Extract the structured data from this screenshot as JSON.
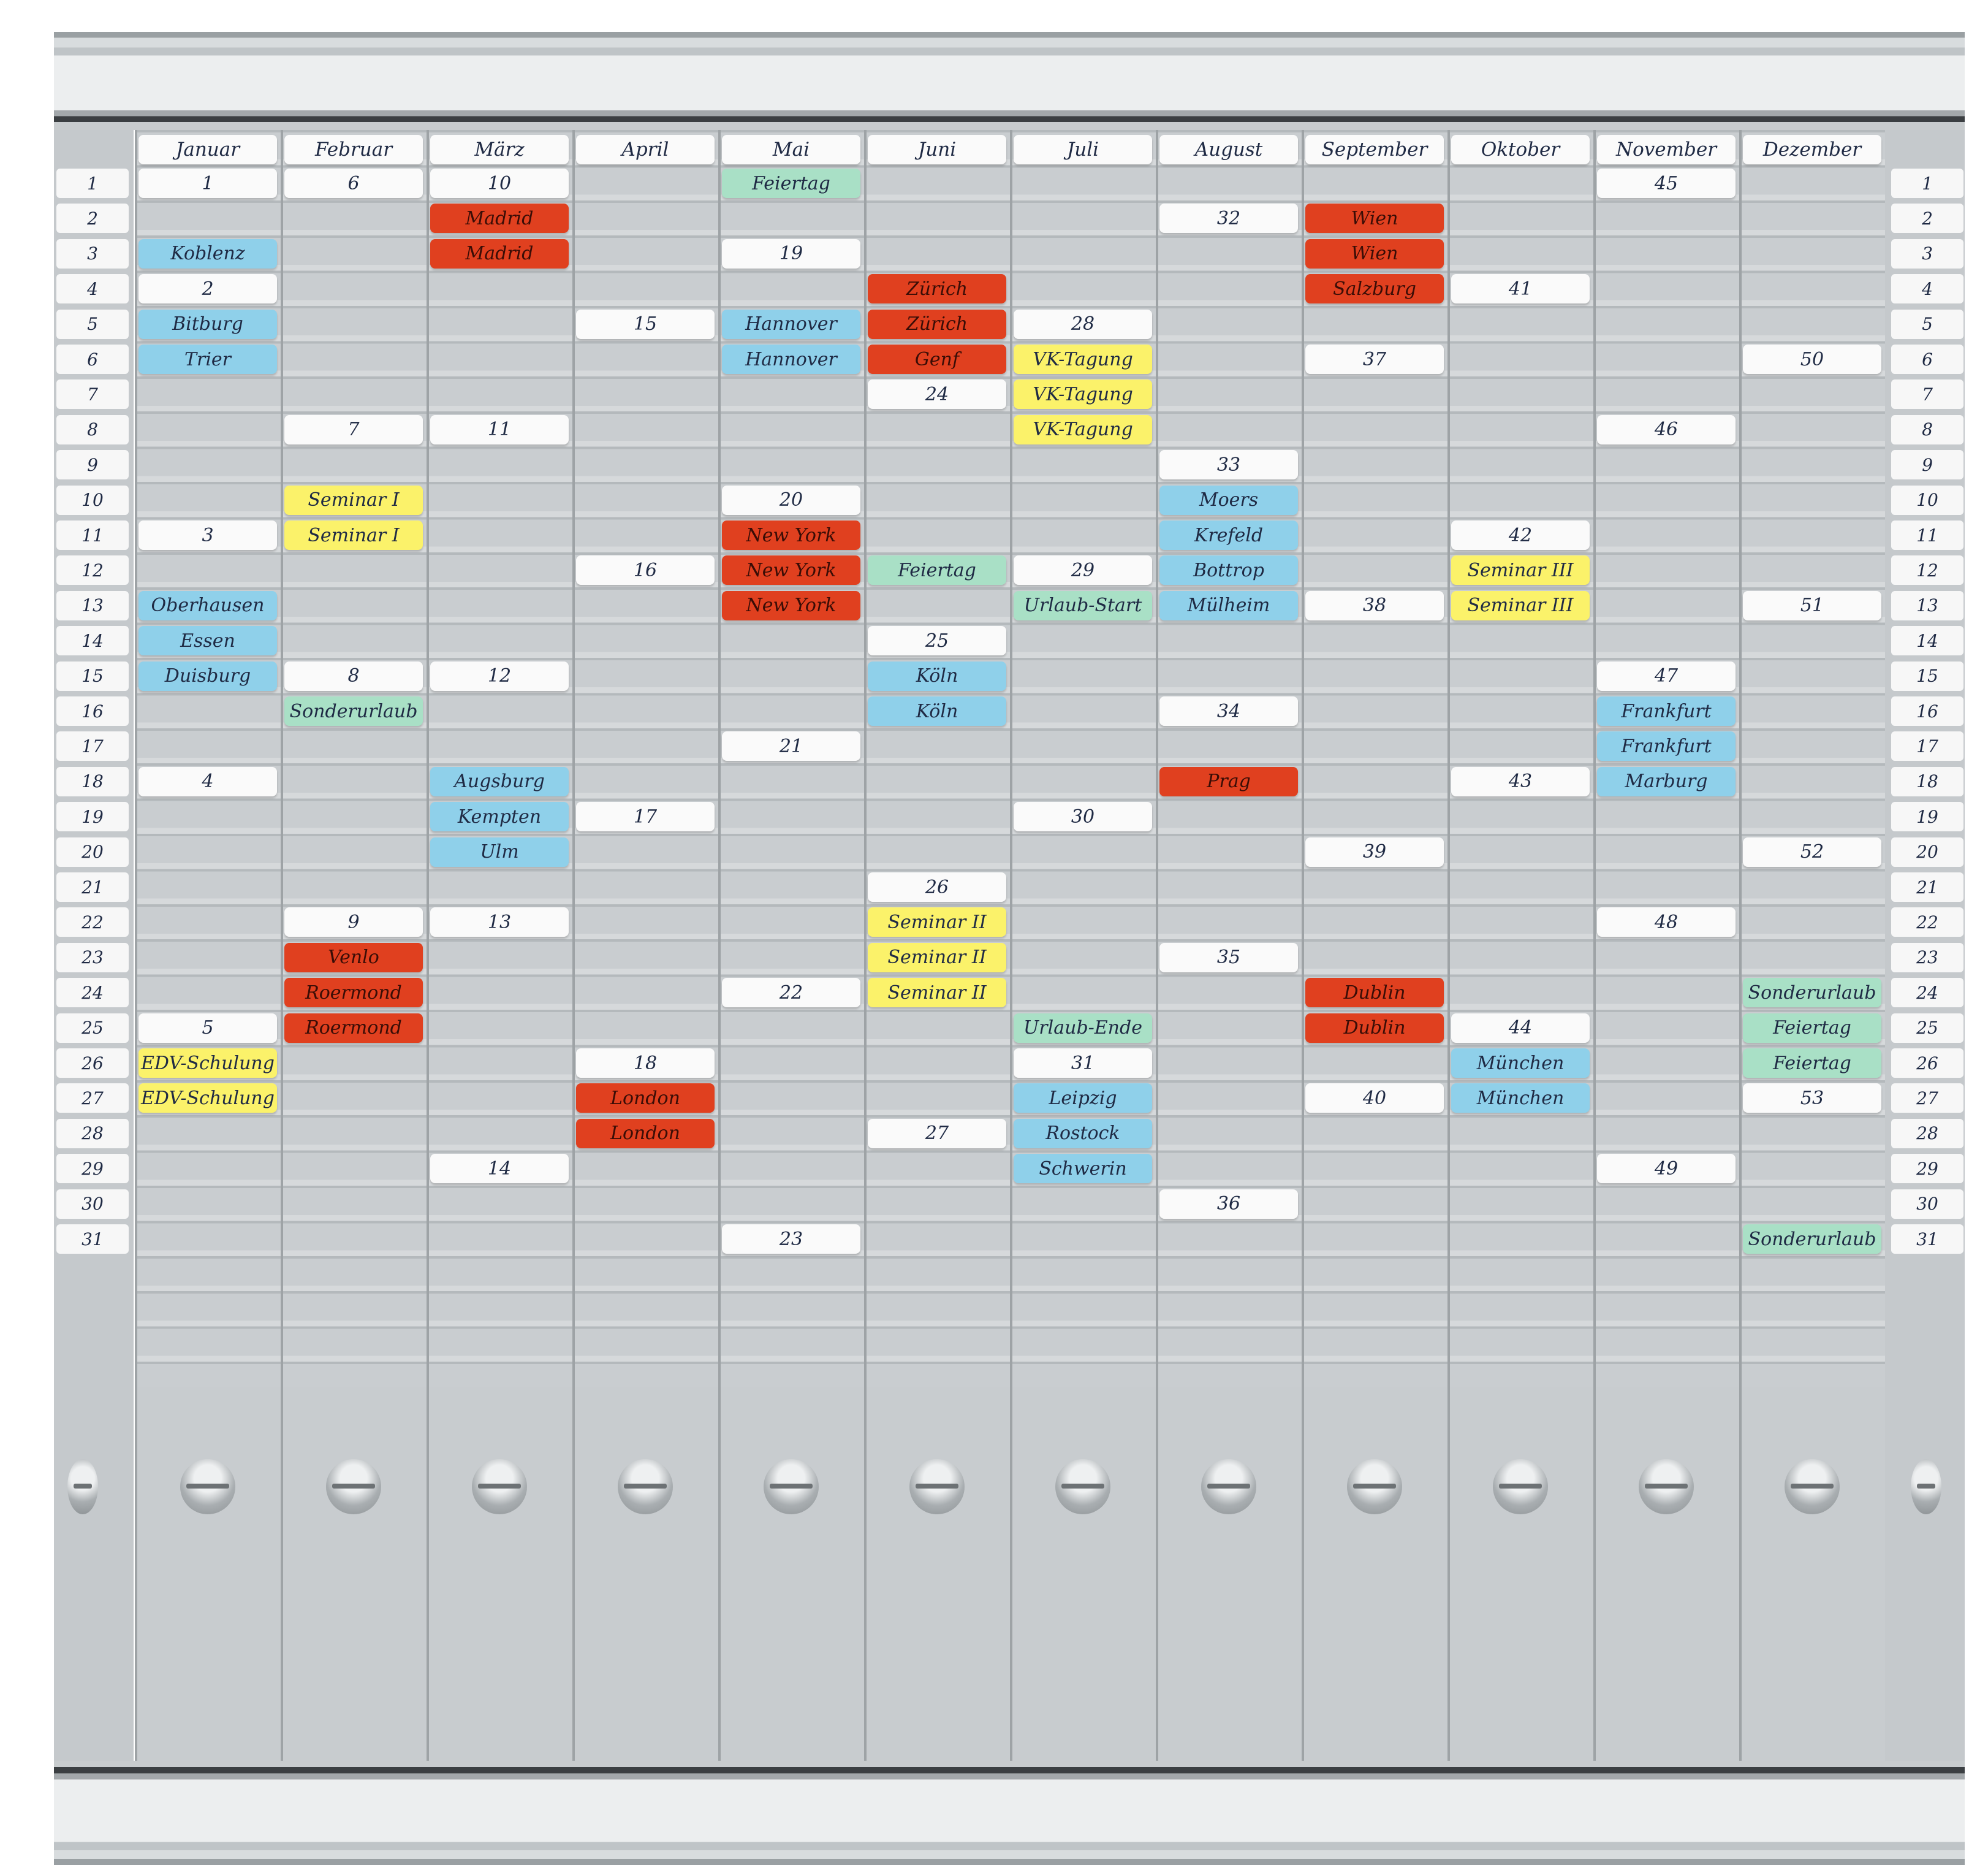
{
  "months": [
    "Januar",
    "Februar",
    "März",
    "April",
    "Mai",
    "Juni",
    "Juli",
    "August",
    "September",
    "Oktober",
    "November",
    "Dezember"
  ],
  "day_numbers": [
    "1",
    "2",
    "3",
    "4",
    "5",
    "6",
    "7",
    "8",
    "9",
    "10",
    "11",
    "12",
    "13",
    "14",
    "15",
    "16",
    "17",
    "18",
    "19",
    "20",
    "21",
    "22",
    "23",
    "24",
    "25",
    "26",
    "27",
    "28",
    "29",
    "30",
    "31"
  ],
  "card_colors": {
    "white": "#fafafa",
    "blue": "#8fd0ea",
    "red": "#e0401f",
    "yellow": "#fbf26a",
    "green": "#a9e0c6"
  },
  "cards": [
    {
      "month": 0,
      "row": 1,
      "text": "1",
      "color": "white"
    },
    {
      "month": 0,
      "row": 3,
      "text": "Koblenz",
      "color": "blue"
    },
    {
      "month": 0,
      "row": 4,
      "text": "2",
      "color": "white"
    },
    {
      "month": 0,
      "row": 5,
      "text": "Bitburg",
      "color": "blue"
    },
    {
      "month": 0,
      "row": 6,
      "text": "Trier",
      "color": "blue"
    },
    {
      "month": 0,
      "row": 11,
      "text": "3",
      "color": "white"
    },
    {
      "month": 0,
      "row": 13,
      "text": "Oberhausen",
      "color": "blue"
    },
    {
      "month": 0,
      "row": 14,
      "text": "Essen",
      "color": "blue"
    },
    {
      "month": 0,
      "row": 15,
      "text": "Duisburg",
      "color": "blue"
    },
    {
      "month": 0,
      "row": 18,
      "text": "4",
      "color": "white"
    },
    {
      "month": 0,
      "row": 25,
      "text": "5",
      "color": "white"
    },
    {
      "month": 0,
      "row": 26,
      "text": "EDV-Schulung",
      "color": "yellow"
    },
    {
      "month": 0,
      "row": 27,
      "text": "EDV-Schulung",
      "color": "yellow"
    },
    {
      "month": 1,
      "row": 1,
      "text": "6",
      "color": "white"
    },
    {
      "month": 1,
      "row": 8,
      "text": "7",
      "color": "white"
    },
    {
      "month": 1,
      "row": 10,
      "text": "Seminar I",
      "color": "yellow"
    },
    {
      "month": 1,
      "row": 11,
      "text": "Seminar I",
      "color": "yellow"
    },
    {
      "month": 1,
      "row": 15,
      "text": "8",
      "color": "white"
    },
    {
      "month": 1,
      "row": 16,
      "text": "Sonderurlaub",
      "color": "green"
    },
    {
      "month": 1,
      "row": 22,
      "text": "9",
      "color": "white"
    },
    {
      "month": 1,
      "row": 23,
      "text": "Venlo",
      "color": "red"
    },
    {
      "month": 1,
      "row": 24,
      "text": "Roermond",
      "color": "red"
    },
    {
      "month": 1,
      "row": 25,
      "text": "Roermond",
      "color": "red"
    },
    {
      "month": 2,
      "row": 1,
      "text": "10",
      "color": "white"
    },
    {
      "month": 2,
      "row": 2,
      "text": "Madrid",
      "color": "red"
    },
    {
      "month": 2,
      "row": 3,
      "text": "Madrid",
      "color": "red"
    },
    {
      "month": 2,
      "row": 8,
      "text": "11",
      "color": "white"
    },
    {
      "month": 2,
      "row": 15,
      "text": "12",
      "color": "white"
    },
    {
      "month": 2,
      "row": 18,
      "text": "Augsburg",
      "color": "blue"
    },
    {
      "month": 2,
      "row": 19,
      "text": "Kempten",
      "color": "blue"
    },
    {
      "month": 2,
      "row": 20,
      "text": "Ulm",
      "color": "blue"
    },
    {
      "month": 2,
      "row": 22,
      "text": "13",
      "color": "white"
    },
    {
      "month": 2,
      "row": 29,
      "text": "14",
      "color": "white"
    },
    {
      "month": 3,
      "row": 5,
      "text": "15",
      "color": "white"
    },
    {
      "month": 3,
      "row": 12,
      "text": "16",
      "color": "white"
    },
    {
      "month": 3,
      "row": 19,
      "text": "17",
      "color": "white"
    },
    {
      "month": 3,
      "row": 26,
      "text": "18",
      "color": "white"
    },
    {
      "month": 3,
      "row": 27,
      "text": "London",
      "color": "red"
    },
    {
      "month": 3,
      "row": 28,
      "text": "London",
      "color": "red"
    },
    {
      "month": 4,
      "row": 1,
      "text": "Feiertag",
      "color": "green"
    },
    {
      "month": 4,
      "row": 3,
      "text": "19",
      "color": "white"
    },
    {
      "month": 4,
      "row": 5,
      "text": "Hannover",
      "color": "blue"
    },
    {
      "month": 4,
      "row": 6,
      "text": "Hannover",
      "color": "blue"
    },
    {
      "month": 4,
      "row": 10,
      "text": "20",
      "color": "white"
    },
    {
      "month": 4,
      "row": 11,
      "text": "New York",
      "color": "red"
    },
    {
      "month": 4,
      "row": 12,
      "text": "New York",
      "color": "red"
    },
    {
      "month": 4,
      "row": 13,
      "text": "New York",
      "color": "red"
    },
    {
      "month": 4,
      "row": 17,
      "text": "21",
      "color": "white"
    },
    {
      "month": 4,
      "row": 24,
      "text": "22",
      "color": "white"
    },
    {
      "month": 4,
      "row": 31,
      "text": "23",
      "color": "white"
    },
    {
      "month": 5,
      "row": 4,
      "text": "Zürich",
      "color": "red"
    },
    {
      "month": 5,
      "row": 5,
      "text": "Zürich",
      "color": "red"
    },
    {
      "month": 5,
      "row": 6,
      "text": "Genf",
      "color": "red"
    },
    {
      "month": 5,
      "row": 7,
      "text": "24",
      "color": "white"
    },
    {
      "month": 5,
      "row": 12,
      "text": "Feiertag",
      "color": "green"
    },
    {
      "month": 5,
      "row": 14,
      "text": "25",
      "color": "white"
    },
    {
      "month": 5,
      "row": 15,
      "text": "Köln",
      "color": "blue"
    },
    {
      "month": 5,
      "row": 16,
      "text": "Köln",
      "color": "blue"
    },
    {
      "month": 5,
      "row": 21,
      "text": "26",
      "color": "white"
    },
    {
      "month": 5,
      "row": 22,
      "text": "Seminar II",
      "color": "yellow"
    },
    {
      "month": 5,
      "row": 23,
      "text": "Seminar II",
      "color": "yellow"
    },
    {
      "month": 5,
      "row": 24,
      "text": "Seminar II",
      "color": "yellow"
    },
    {
      "month": 5,
      "row": 28,
      "text": "27",
      "color": "white"
    },
    {
      "month": 6,
      "row": 5,
      "text": "28",
      "color": "white"
    },
    {
      "month": 6,
      "row": 6,
      "text": "VK-Tagung",
      "color": "yellow"
    },
    {
      "month": 6,
      "row": 7,
      "text": "VK-Tagung",
      "color": "yellow"
    },
    {
      "month": 6,
      "row": 8,
      "text": "VK-Tagung",
      "color": "yellow"
    },
    {
      "month": 6,
      "row": 12,
      "text": "29",
      "color": "white"
    },
    {
      "month": 6,
      "row": 13,
      "text": "Urlaub-Start",
      "color": "green"
    },
    {
      "month": 6,
      "row": 19,
      "text": "30",
      "color": "white"
    },
    {
      "month": 6,
      "row": 25,
      "text": "Urlaub-Ende",
      "color": "green"
    },
    {
      "month": 6,
      "row": 26,
      "text": "31",
      "color": "white"
    },
    {
      "month": 6,
      "row": 27,
      "text": "Leipzig",
      "color": "blue"
    },
    {
      "month": 6,
      "row": 28,
      "text": "Rostock",
      "color": "blue"
    },
    {
      "month": 6,
      "row": 29,
      "text": "Schwerin",
      "color": "blue"
    },
    {
      "month": 7,
      "row": 2,
      "text": "32",
      "color": "white"
    },
    {
      "month": 7,
      "row": 9,
      "text": "33",
      "color": "white"
    },
    {
      "month": 7,
      "row": 10,
      "text": "Moers",
      "color": "blue"
    },
    {
      "month": 7,
      "row": 11,
      "text": "Krefeld",
      "color": "blue"
    },
    {
      "month": 7,
      "row": 12,
      "text": "Bottrop",
      "color": "blue"
    },
    {
      "month": 7,
      "row": 13,
      "text": "Mülheim",
      "color": "blue"
    },
    {
      "month": 7,
      "row": 16,
      "text": "34",
      "color": "white"
    },
    {
      "month": 7,
      "row": 18,
      "text": "Prag",
      "color": "red"
    },
    {
      "month": 7,
      "row": 23,
      "text": "35",
      "color": "white"
    },
    {
      "month": 7,
      "row": 30,
      "text": "36",
      "color": "white"
    },
    {
      "month": 8,
      "row": 2,
      "text": "Wien",
      "color": "red"
    },
    {
      "month": 8,
      "row": 3,
      "text": "Wien",
      "color": "red"
    },
    {
      "month": 8,
      "row": 4,
      "text": "Salzburg",
      "color": "red"
    },
    {
      "month": 8,
      "row": 6,
      "text": "37",
      "color": "white"
    },
    {
      "month": 8,
      "row": 13,
      "text": "38",
      "color": "white"
    },
    {
      "month": 8,
      "row": 20,
      "text": "39",
      "color": "white"
    },
    {
      "month": 8,
      "row": 24,
      "text": "Dublin",
      "color": "red"
    },
    {
      "month": 8,
      "row": 25,
      "text": "Dublin",
      "color": "red"
    },
    {
      "month": 8,
      "row": 27,
      "text": "40",
      "color": "white"
    },
    {
      "month": 9,
      "row": 4,
      "text": "41",
      "color": "white"
    },
    {
      "month": 9,
      "row": 11,
      "text": "42",
      "color": "white"
    },
    {
      "month": 9,
      "row": 12,
      "text": "Seminar III",
      "color": "yellow"
    },
    {
      "month": 9,
      "row": 13,
      "text": "Seminar III",
      "color": "yellow"
    },
    {
      "month": 9,
      "row": 18,
      "text": "43",
      "color": "white"
    },
    {
      "month": 9,
      "row": 25,
      "text": "44",
      "color": "white"
    },
    {
      "month": 9,
      "row": 26,
      "text": "München",
      "color": "blue"
    },
    {
      "month": 9,
      "row": 27,
      "text": "München",
      "color": "blue"
    },
    {
      "month": 10,
      "row": 1,
      "text": "45",
      "color": "white"
    },
    {
      "month": 10,
      "row": 8,
      "text": "46",
      "color": "white"
    },
    {
      "month": 10,
      "row": 15,
      "text": "47",
      "color": "white"
    },
    {
      "month": 10,
      "row": 16,
      "text": "Frankfurt",
      "color": "blue"
    },
    {
      "month": 10,
      "row": 17,
      "text": "Frankfurt",
      "color": "blue"
    },
    {
      "month": 10,
      "row": 18,
      "text": "Marburg",
      "color": "blue"
    },
    {
      "month": 10,
      "row": 22,
      "text": "48",
      "color": "white"
    },
    {
      "month": 10,
      "row": 29,
      "text": "49",
      "color": "white"
    },
    {
      "month": 11,
      "row": 6,
      "text": "50",
      "color": "white"
    },
    {
      "month": 11,
      "row": 13,
      "text": "51",
      "color": "white"
    },
    {
      "month": 11,
      "row": 20,
      "text": "52",
      "color": "white"
    },
    {
      "month": 11,
      "row": 24,
      "text": "Sonderurlaub",
      "color": "green"
    },
    {
      "month": 11,
      "row": 25,
      "text": "Feiertag",
      "color": "green"
    },
    {
      "month": 11,
      "row": 26,
      "text": "Feiertag",
      "color": "green"
    },
    {
      "month": 11,
      "row": 27,
      "text": "53",
      "color": "white"
    },
    {
      "month": 11,
      "row": 31,
      "text": "Sonderurlaub",
      "color": "green"
    }
  ]
}
